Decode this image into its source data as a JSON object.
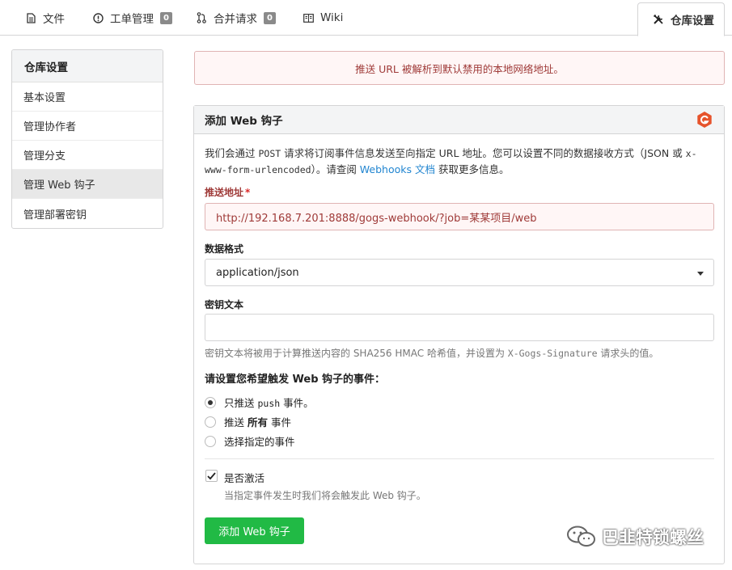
{
  "tabs": [
    {
      "label": "文件",
      "icon": "file-icon"
    },
    {
      "label": "工单管理",
      "badge": "0",
      "icon": "issue-icon"
    },
    {
      "label": "合并请求",
      "badge": "0",
      "icon": "pull-request-icon"
    },
    {
      "label": "Wiki",
      "icon": "book-icon"
    },
    {
      "label": "仓库设置",
      "icon": "tools-icon",
      "active": true
    }
  ],
  "sidebar": {
    "title": "仓库设置",
    "items": [
      {
        "label": "基本设置"
      },
      {
        "label": "管理协作者"
      },
      {
        "label": "管理分支"
      },
      {
        "label": "管理 Web 钩子",
        "selected": true
      },
      {
        "label": "管理部署密钥"
      }
    ]
  },
  "alert": {
    "text": "推送 URL 被解析到默认禁用的本地网络地址。",
    "color": "#9f3a38"
  },
  "form": {
    "title": "添加 Web 钩子",
    "desc": {
      "p1": "我们会通过 ",
      "code1": "POST",
      "p2": " 请求将订阅事件信息发送至向指定 URL 地址。您可以设置不同的数据接收方式（JSON 或 ",
      "code2": "x-www-form-urlencoded",
      "p3": "）。请查阅 ",
      "link": "Webhooks 文档",
      "p4": " 获取更多信息。"
    },
    "url": {
      "label": "推送地址",
      "required_mark": "*",
      "value": "http://192.168.7.201:8888/gogs-webhook/?job=某某项目/web"
    },
    "content_type": {
      "label": "数据格式",
      "value": "application/json"
    },
    "secret": {
      "label": "密钥文本",
      "value": "",
      "hint_a": "密钥文本将被用于计算推送内容的 SHA256 HMAC 哈希值，并设置为 ",
      "hint_code": "X-Gogs-Signature",
      "hint_b": " 请求头的值。"
    },
    "events": {
      "label": "请设置您希望触发 Web 钩子的事件：",
      "push_a": "只推送 ",
      "push_code": "push",
      "push_b": " 事件。",
      "all_a": "推送 ",
      "all_b": "所有",
      "all_c": " 事件",
      "choose": "选择指定的事件",
      "selected": "push"
    },
    "active": {
      "label": "是否激活",
      "checked": true,
      "hint": "当指定事件发生时我们将会触发此 Web 钩子。"
    },
    "submit": "添加 Web 钩子"
  },
  "watermark": {
    "text": "巴韭特锁螺丝",
    "icon": "wechat-icon"
  },
  "colors": {
    "accent_green": "#21ba45",
    "link_blue": "#2185d0",
    "error_red": "#9f3a38",
    "gogs_orange": "#e6532b"
  }
}
